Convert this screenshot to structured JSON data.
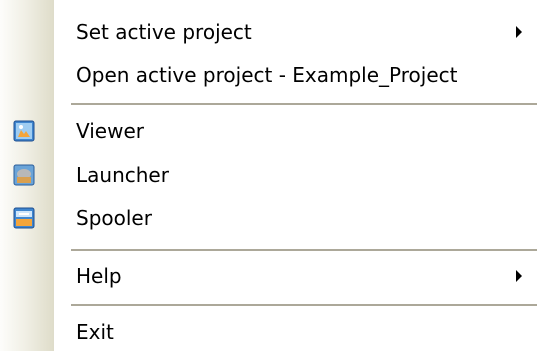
{
  "menu": {
    "set_active_project": "Set active project",
    "open_active_project": "Open active project - Example_Project",
    "viewer": "Viewer",
    "launcher": "Launcher",
    "spooler": "Spooler",
    "help": "Help",
    "exit": "Exit"
  },
  "icons": {
    "viewer": "viewer-icon",
    "launcher": "launcher-icon",
    "spooler": "spooler-icon",
    "submenu_arrow": "submenu-arrow-icon"
  },
  "colors": {
    "separator": "#aca899",
    "gutter_dark": "#dedcc9",
    "icon_blue": "#2f6fb8",
    "icon_orange": "#f4a53a"
  }
}
